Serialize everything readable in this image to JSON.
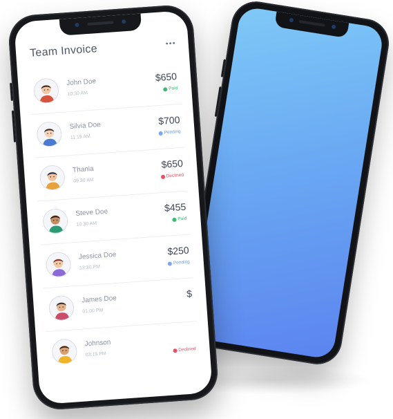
{
  "app": {
    "title": "Team Invoice"
  },
  "invoices": [
    {
      "name": "John Doe",
      "time": "10:30 AM",
      "amount": "$650",
      "status": "Paid",
      "status_kind": "paid"
    },
    {
      "name": "Silvia Doe",
      "time": "11:15 AM",
      "amount": "$700",
      "status": "Pending",
      "status_kind": "pending"
    },
    {
      "name": "Thania",
      "time": "09:30 AM",
      "amount": "$650",
      "status": "Declined",
      "status_kind": "declined"
    },
    {
      "name": "Steve Doe",
      "time": "10:30 AM",
      "amount": "$455",
      "status": "Paid",
      "status_kind": "paid"
    },
    {
      "name": "Jessica Doe",
      "time": "12:30 PM",
      "amount": "$250",
      "status": "Pending",
      "status_kind": "pending"
    },
    {
      "name": "James Doe",
      "time": "01:00 PM",
      "amount": "$",
      "status": "",
      "status_kind": "none"
    },
    {
      "name": "Johnson",
      "time": "03:15 PM",
      "amount": "",
      "status": "Declined",
      "status_kind": "declined"
    }
  ],
  "colors": {
    "screen_gradient_top": "#7fc9f7",
    "screen_gradient_bottom": "#5b84ef",
    "paid": "#3dbb72",
    "pending": "#7ba6f2",
    "declined": "#ef4d64",
    "phone_body": "#16181c"
  },
  "icons": {
    "more": "more-horizontal-icon",
    "status": "status-dot-icon",
    "avatar": "user-avatar-icon"
  }
}
